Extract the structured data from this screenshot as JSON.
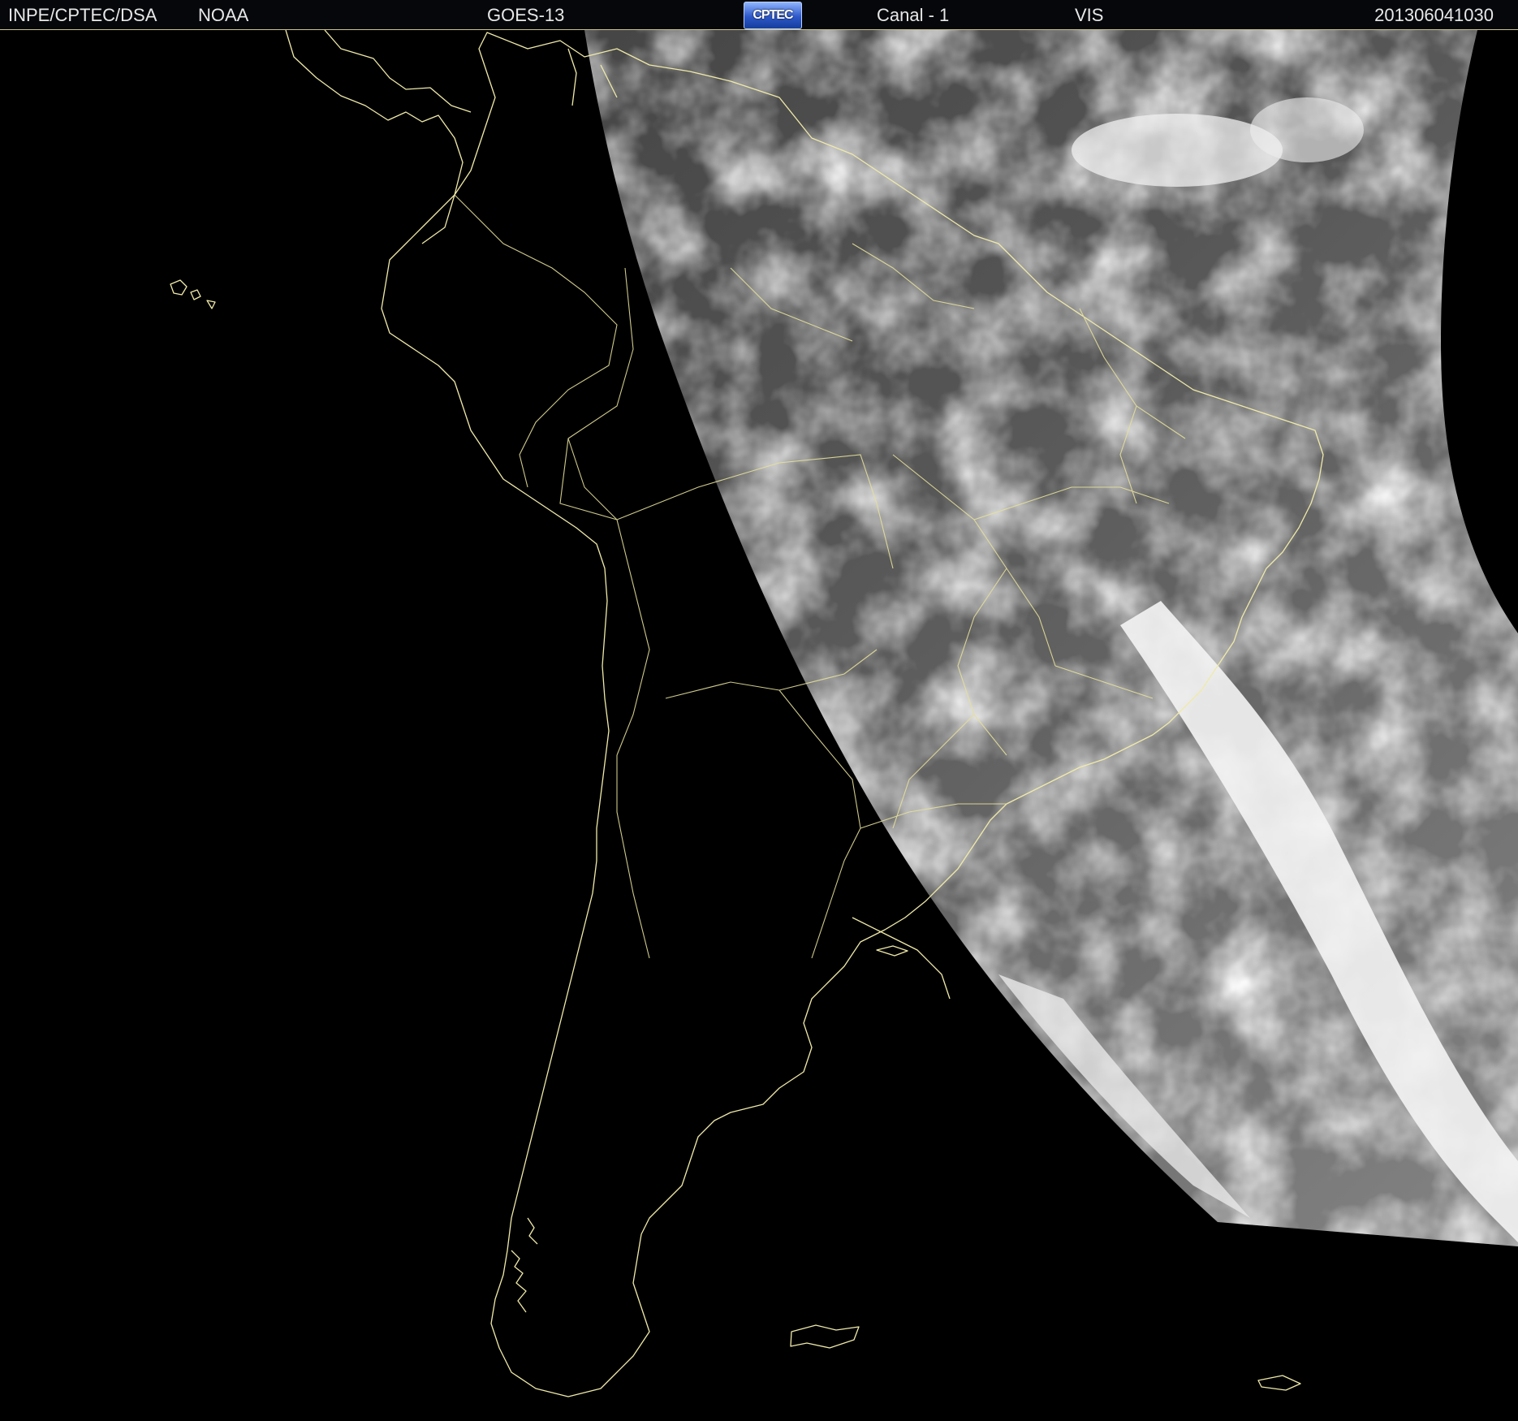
{
  "header": {
    "source": "INPE/CPTEC/DSA",
    "agency": "NOAA",
    "satellite": "GOES-13",
    "logo_text": "CPTEC",
    "channel": "Canal - 1",
    "band": "VIS",
    "timestamp": "201306041030"
  },
  "colors": {
    "header_bg": "#05070b",
    "header_text": "#e8e8e8",
    "coastline": "#f0eaa8",
    "ocean_night": "#000000",
    "cloud_bright": "#f2f2f2",
    "land_day": "#4a4a4a"
  },
  "icons": {
    "logo": "cptec-logo"
  }
}
